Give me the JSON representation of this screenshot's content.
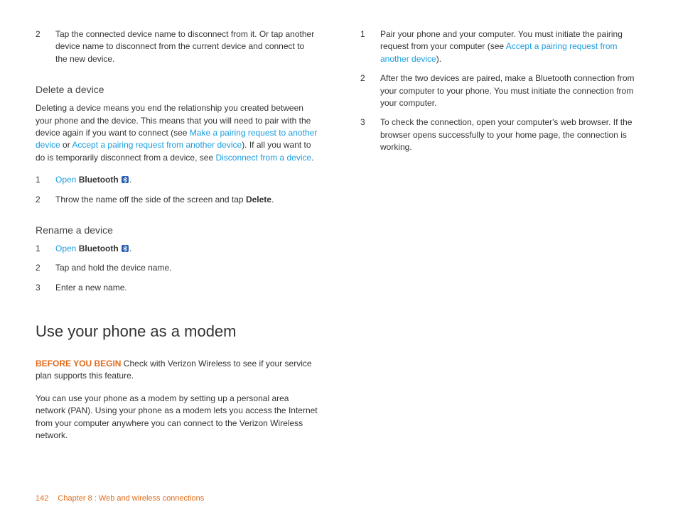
{
  "left": {
    "step2": "Tap the connected device name to disconnect from it. Or tap another device name to disconnect from the current device and connect to the new device.",
    "delete_h": "Delete a device",
    "delete_p1a": "Deleting a device means you end the relationship you created between your phone and the device. This means that you will need to pair with the device again if you want to connect (see ",
    "delete_link1": "Make a pairing request to another device",
    "delete_p1b": " or ",
    "delete_link2": "Accept a pairing request from another device",
    "delete_p1c": "). If all you want to do is temporarily disconnect from a device, see ",
    "delete_link3": "Disconnect from a device",
    "delete_p1d": ".",
    "delete_s1_open": "Open",
    "delete_s1_bt": " Bluetooth ",
    "delete_s2a": "Throw the name off the side of the screen and tap ",
    "delete_s2b": "Delete",
    "delete_s2c": ".",
    "rename_h": "Rename a device",
    "rename_s1_open": "Open",
    "rename_s1_bt": " Bluetooth ",
    "rename_s2": "Tap and hold the device name.",
    "rename_s3": "Enter a new name.",
    "modem_h": "Use your phone as a modem",
    "modem_warn": "BEFORE YOU BEGIN",
    "modem_p1": " Check with Verizon Wireless to see if your service plan supports this feature.",
    "modem_p2": "You can use your phone as a modem by setting up a personal area network (PAN). Using your phone as a modem lets you access the Internet from your computer anywhere you can connect to the Verizon Wireless network."
  },
  "right": {
    "s1a": "Pair your phone and your computer. You must initiate the pairing request from your computer (see ",
    "s1_link": "Accept a pairing request from another device",
    "s1b": ").",
    "s2": "After the two devices are paired, make a Bluetooth connection from your computer to your phone. You must initiate the connection from your computer.",
    "s3": "To check the connection, open your computer's web browser. If the browser opens successfully to your home page, the connection is working."
  },
  "footer": {
    "page": "142",
    "crumb": "Chapter 8  :  Web and wireless connections"
  },
  "nums": {
    "n1": "1",
    "n2": "2",
    "n3": "3"
  }
}
